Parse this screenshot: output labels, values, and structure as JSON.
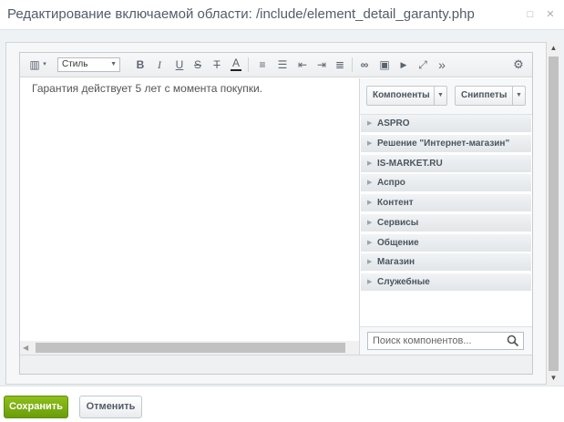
{
  "window": {
    "title": "Редактирование включаемой области: /include/element_detail_garanty.php",
    "maximize_glyph": "□",
    "close_glyph": "✕"
  },
  "toolbar": {
    "style_select_value": "Стиль",
    "buttons": [
      {
        "name": "view-mode-icon",
        "glyph": "▥"
      },
      {
        "name": "bold-icon",
        "glyph": "B"
      },
      {
        "name": "italic-icon",
        "glyph": "I"
      },
      {
        "name": "underline-icon",
        "glyph": "U"
      },
      {
        "name": "strikethrough-icon",
        "glyph": "S"
      },
      {
        "name": "remove-format-icon",
        "glyph": "T"
      },
      {
        "name": "font-color-icon",
        "glyph": "A"
      },
      {
        "name": "ordered-list-icon",
        "glyph": "≡"
      },
      {
        "name": "unordered-list-icon",
        "glyph": "☰"
      },
      {
        "name": "outdent-icon",
        "glyph": "⇤"
      },
      {
        "name": "indent-icon",
        "glyph": "⇥"
      },
      {
        "name": "align-icon",
        "glyph": "≣"
      },
      {
        "name": "link-icon",
        "glyph": "∞"
      },
      {
        "name": "image-icon",
        "glyph": "▣"
      },
      {
        "name": "video-icon",
        "glyph": "▶"
      },
      {
        "name": "fullscreen-icon",
        "glyph": "⤢"
      },
      {
        "name": "more-icon",
        "glyph": "»"
      },
      {
        "name": "settings-icon",
        "glyph": "⚙"
      }
    ]
  },
  "editor": {
    "content": "Гарантия действует 5 лет с момента покупки."
  },
  "panel": {
    "components_label": "Компоненты",
    "snippets_label": "Сниппеты",
    "categories": [
      "ASPRO",
      "Решение \"Интернет-магазин\"",
      "IS-MARKET.RU",
      "Аспро",
      "Контент",
      "Сервисы",
      "Общение",
      "Магазин",
      "Служебные"
    ],
    "search_placeholder": "Поиск компонентов..."
  },
  "footer": {
    "save_label": "Сохранить",
    "cancel_label": "Отменить"
  },
  "colors": {
    "save_green": "#7aae12",
    "title_text": "#535c69"
  }
}
